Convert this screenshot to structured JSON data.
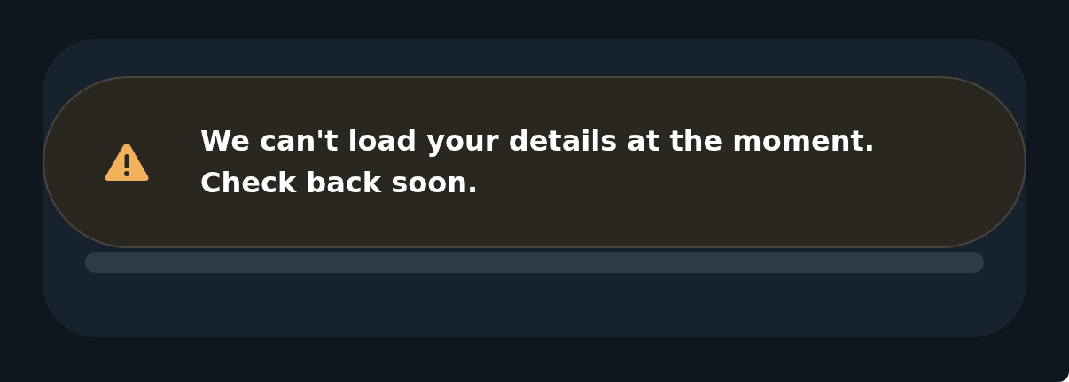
{
  "alert": {
    "kind": "warning",
    "message": "We can't load your details at the moment. Check back soon."
  }
}
